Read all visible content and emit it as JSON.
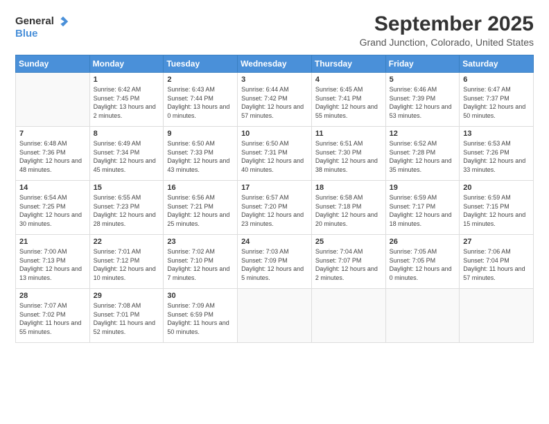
{
  "logo": {
    "general": "General",
    "blue": "Blue"
  },
  "header": {
    "month": "September 2025",
    "location": "Grand Junction, Colorado, United States"
  },
  "weekdays": [
    "Sunday",
    "Monday",
    "Tuesday",
    "Wednesday",
    "Thursday",
    "Friday",
    "Saturday"
  ],
  "weeks": [
    [
      {
        "day": "",
        "sunrise": "",
        "sunset": "",
        "daylight": ""
      },
      {
        "day": "1",
        "sunrise": "Sunrise: 6:42 AM",
        "sunset": "Sunset: 7:45 PM",
        "daylight": "Daylight: 13 hours and 2 minutes."
      },
      {
        "day": "2",
        "sunrise": "Sunrise: 6:43 AM",
        "sunset": "Sunset: 7:44 PM",
        "daylight": "Daylight: 13 hours and 0 minutes."
      },
      {
        "day": "3",
        "sunrise": "Sunrise: 6:44 AM",
        "sunset": "Sunset: 7:42 PM",
        "daylight": "Daylight: 12 hours and 57 minutes."
      },
      {
        "day": "4",
        "sunrise": "Sunrise: 6:45 AM",
        "sunset": "Sunset: 7:41 PM",
        "daylight": "Daylight: 12 hours and 55 minutes."
      },
      {
        "day": "5",
        "sunrise": "Sunrise: 6:46 AM",
        "sunset": "Sunset: 7:39 PM",
        "daylight": "Daylight: 12 hours and 53 minutes."
      },
      {
        "day": "6",
        "sunrise": "Sunrise: 6:47 AM",
        "sunset": "Sunset: 7:37 PM",
        "daylight": "Daylight: 12 hours and 50 minutes."
      }
    ],
    [
      {
        "day": "7",
        "sunrise": "Sunrise: 6:48 AM",
        "sunset": "Sunset: 7:36 PM",
        "daylight": "Daylight: 12 hours and 48 minutes."
      },
      {
        "day": "8",
        "sunrise": "Sunrise: 6:49 AM",
        "sunset": "Sunset: 7:34 PM",
        "daylight": "Daylight: 12 hours and 45 minutes."
      },
      {
        "day": "9",
        "sunrise": "Sunrise: 6:50 AM",
        "sunset": "Sunset: 7:33 PM",
        "daylight": "Daylight: 12 hours and 43 minutes."
      },
      {
        "day": "10",
        "sunrise": "Sunrise: 6:50 AM",
        "sunset": "Sunset: 7:31 PM",
        "daylight": "Daylight: 12 hours and 40 minutes."
      },
      {
        "day": "11",
        "sunrise": "Sunrise: 6:51 AM",
        "sunset": "Sunset: 7:30 PM",
        "daylight": "Daylight: 12 hours and 38 minutes."
      },
      {
        "day": "12",
        "sunrise": "Sunrise: 6:52 AM",
        "sunset": "Sunset: 7:28 PM",
        "daylight": "Daylight: 12 hours and 35 minutes."
      },
      {
        "day": "13",
        "sunrise": "Sunrise: 6:53 AM",
        "sunset": "Sunset: 7:26 PM",
        "daylight": "Daylight: 12 hours and 33 minutes."
      }
    ],
    [
      {
        "day": "14",
        "sunrise": "Sunrise: 6:54 AM",
        "sunset": "Sunset: 7:25 PM",
        "daylight": "Daylight: 12 hours and 30 minutes."
      },
      {
        "day": "15",
        "sunrise": "Sunrise: 6:55 AM",
        "sunset": "Sunset: 7:23 PM",
        "daylight": "Daylight: 12 hours and 28 minutes."
      },
      {
        "day": "16",
        "sunrise": "Sunrise: 6:56 AM",
        "sunset": "Sunset: 7:21 PM",
        "daylight": "Daylight: 12 hours and 25 minutes."
      },
      {
        "day": "17",
        "sunrise": "Sunrise: 6:57 AM",
        "sunset": "Sunset: 7:20 PM",
        "daylight": "Daylight: 12 hours and 23 minutes."
      },
      {
        "day": "18",
        "sunrise": "Sunrise: 6:58 AM",
        "sunset": "Sunset: 7:18 PM",
        "daylight": "Daylight: 12 hours and 20 minutes."
      },
      {
        "day": "19",
        "sunrise": "Sunrise: 6:59 AM",
        "sunset": "Sunset: 7:17 PM",
        "daylight": "Daylight: 12 hours and 18 minutes."
      },
      {
        "day": "20",
        "sunrise": "Sunrise: 6:59 AM",
        "sunset": "Sunset: 7:15 PM",
        "daylight": "Daylight: 12 hours and 15 minutes."
      }
    ],
    [
      {
        "day": "21",
        "sunrise": "Sunrise: 7:00 AM",
        "sunset": "Sunset: 7:13 PM",
        "daylight": "Daylight: 12 hours and 13 minutes."
      },
      {
        "day": "22",
        "sunrise": "Sunrise: 7:01 AM",
        "sunset": "Sunset: 7:12 PM",
        "daylight": "Daylight: 12 hours and 10 minutes."
      },
      {
        "day": "23",
        "sunrise": "Sunrise: 7:02 AM",
        "sunset": "Sunset: 7:10 PM",
        "daylight": "Daylight: 12 hours and 7 minutes."
      },
      {
        "day": "24",
        "sunrise": "Sunrise: 7:03 AM",
        "sunset": "Sunset: 7:09 PM",
        "daylight": "Daylight: 12 hours and 5 minutes."
      },
      {
        "day": "25",
        "sunrise": "Sunrise: 7:04 AM",
        "sunset": "Sunset: 7:07 PM",
        "daylight": "Daylight: 12 hours and 2 minutes."
      },
      {
        "day": "26",
        "sunrise": "Sunrise: 7:05 AM",
        "sunset": "Sunset: 7:05 PM",
        "daylight": "Daylight: 12 hours and 0 minutes."
      },
      {
        "day": "27",
        "sunrise": "Sunrise: 7:06 AM",
        "sunset": "Sunset: 7:04 PM",
        "daylight": "Daylight: 11 hours and 57 minutes."
      }
    ],
    [
      {
        "day": "28",
        "sunrise": "Sunrise: 7:07 AM",
        "sunset": "Sunset: 7:02 PM",
        "daylight": "Daylight: 11 hours and 55 minutes."
      },
      {
        "day": "29",
        "sunrise": "Sunrise: 7:08 AM",
        "sunset": "Sunset: 7:01 PM",
        "daylight": "Daylight: 11 hours and 52 minutes."
      },
      {
        "day": "30",
        "sunrise": "Sunrise: 7:09 AM",
        "sunset": "Sunset: 6:59 PM",
        "daylight": "Daylight: 11 hours and 50 minutes."
      },
      {
        "day": "",
        "sunrise": "",
        "sunset": "",
        "daylight": ""
      },
      {
        "day": "",
        "sunrise": "",
        "sunset": "",
        "daylight": ""
      },
      {
        "day": "",
        "sunrise": "",
        "sunset": "",
        "daylight": ""
      },
      {
        "day": "",
        "sunrise": "",
        "sunset": "",
        "daylight": ""
      }
    ]
  ]
}
